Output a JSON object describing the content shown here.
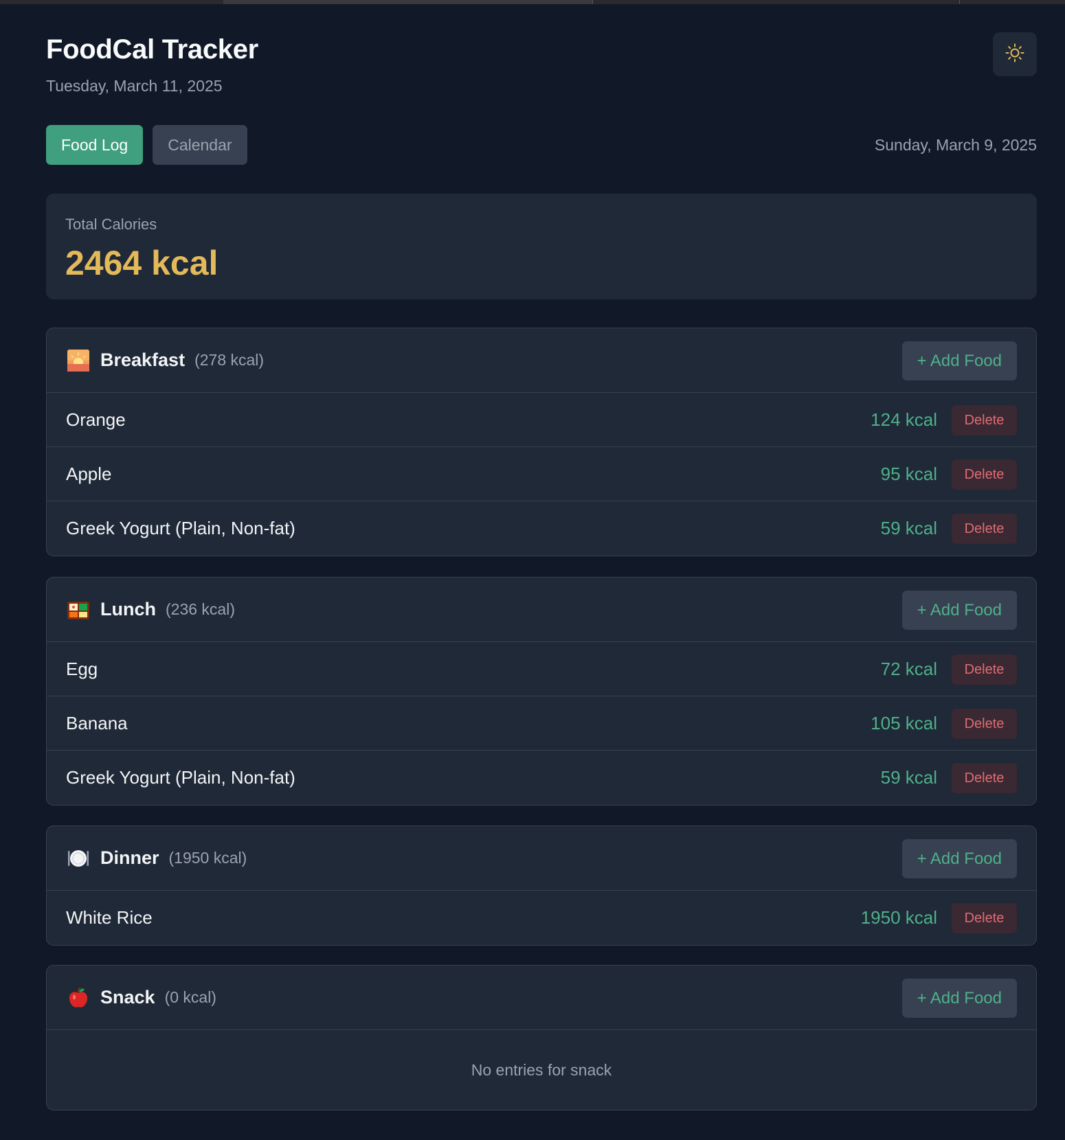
{
  "app": {
    "title": "FoodCal Tracker",
    "today": "Tuesday, March 11, 2025"
  },
  "tabs": [
    {
      "label": "Food Log",
      "active": true
    },
    {
      "label": "Calendar",
      "active": false
    }
  ],
  "selected_date": "Sunday, March 9, 2025",
  "total": {
    "label": "Total Calories",
    "value": "2464 kcal"
  },
  "theme_toggle_icon": "sun-icon",
  "add_label": "+ Add Food",
  "delete_label": "Delete",
  "meals": {
    "breakfast": {
      "icon": "sunrise-icon",
      "name": "Breakfast",
      "kcal": "(278 kcal)",
      "items": [
        {
          "name": "Orange",
          "kcal": "124 kcal"
        },
        {
          "name": "Apple",
          "kcal": "95 kcal"
        },
        {
          "name": "Greek Yogurt (Plain, Non-fat)",
          "kcal": "59 kcal"
        }
      ]
    },
    "lunch": {
      "icon": "bento-box-icon",
      "name": "Lunch",
      "kcal": "(236 kcal)",
      "items": [
        {
          "name": "Egg",
          "kcal": "72 kcal"
        },
        {
          "name": "Banana",
          "kcal": "105 kcal"
        },
        {
          "name": "Greek Yogurt (Plain, Non-fat)",
          "kcal": "59 kcal"
        }
      ]
    },
    "dinner": {
      "icon": "plate-cutlery-icon",
      "name": "Dinner",
      "kcal": "(1950 kcal)",
      "items": [
        {
          "name": "White Rice",
          "kcal": "1950 kcal"
        }
      ]
    },
    "snack": {
      "icon": "red-apple-icon",
      "name": "Snack",
      "kcal": "(0 kcal)",
      "items": [],
      "empty_text": "No entries for snack"
    }
  },
  "colors": {
    "background": "#111827",
    "card": "#1f2937",
    "accent_green": "#3f9f7e",
    "kcal_green": "#4fb08a",
    "total_gold": "#e3b95a",
    "delete_red": "#e06c75"
  }
}
